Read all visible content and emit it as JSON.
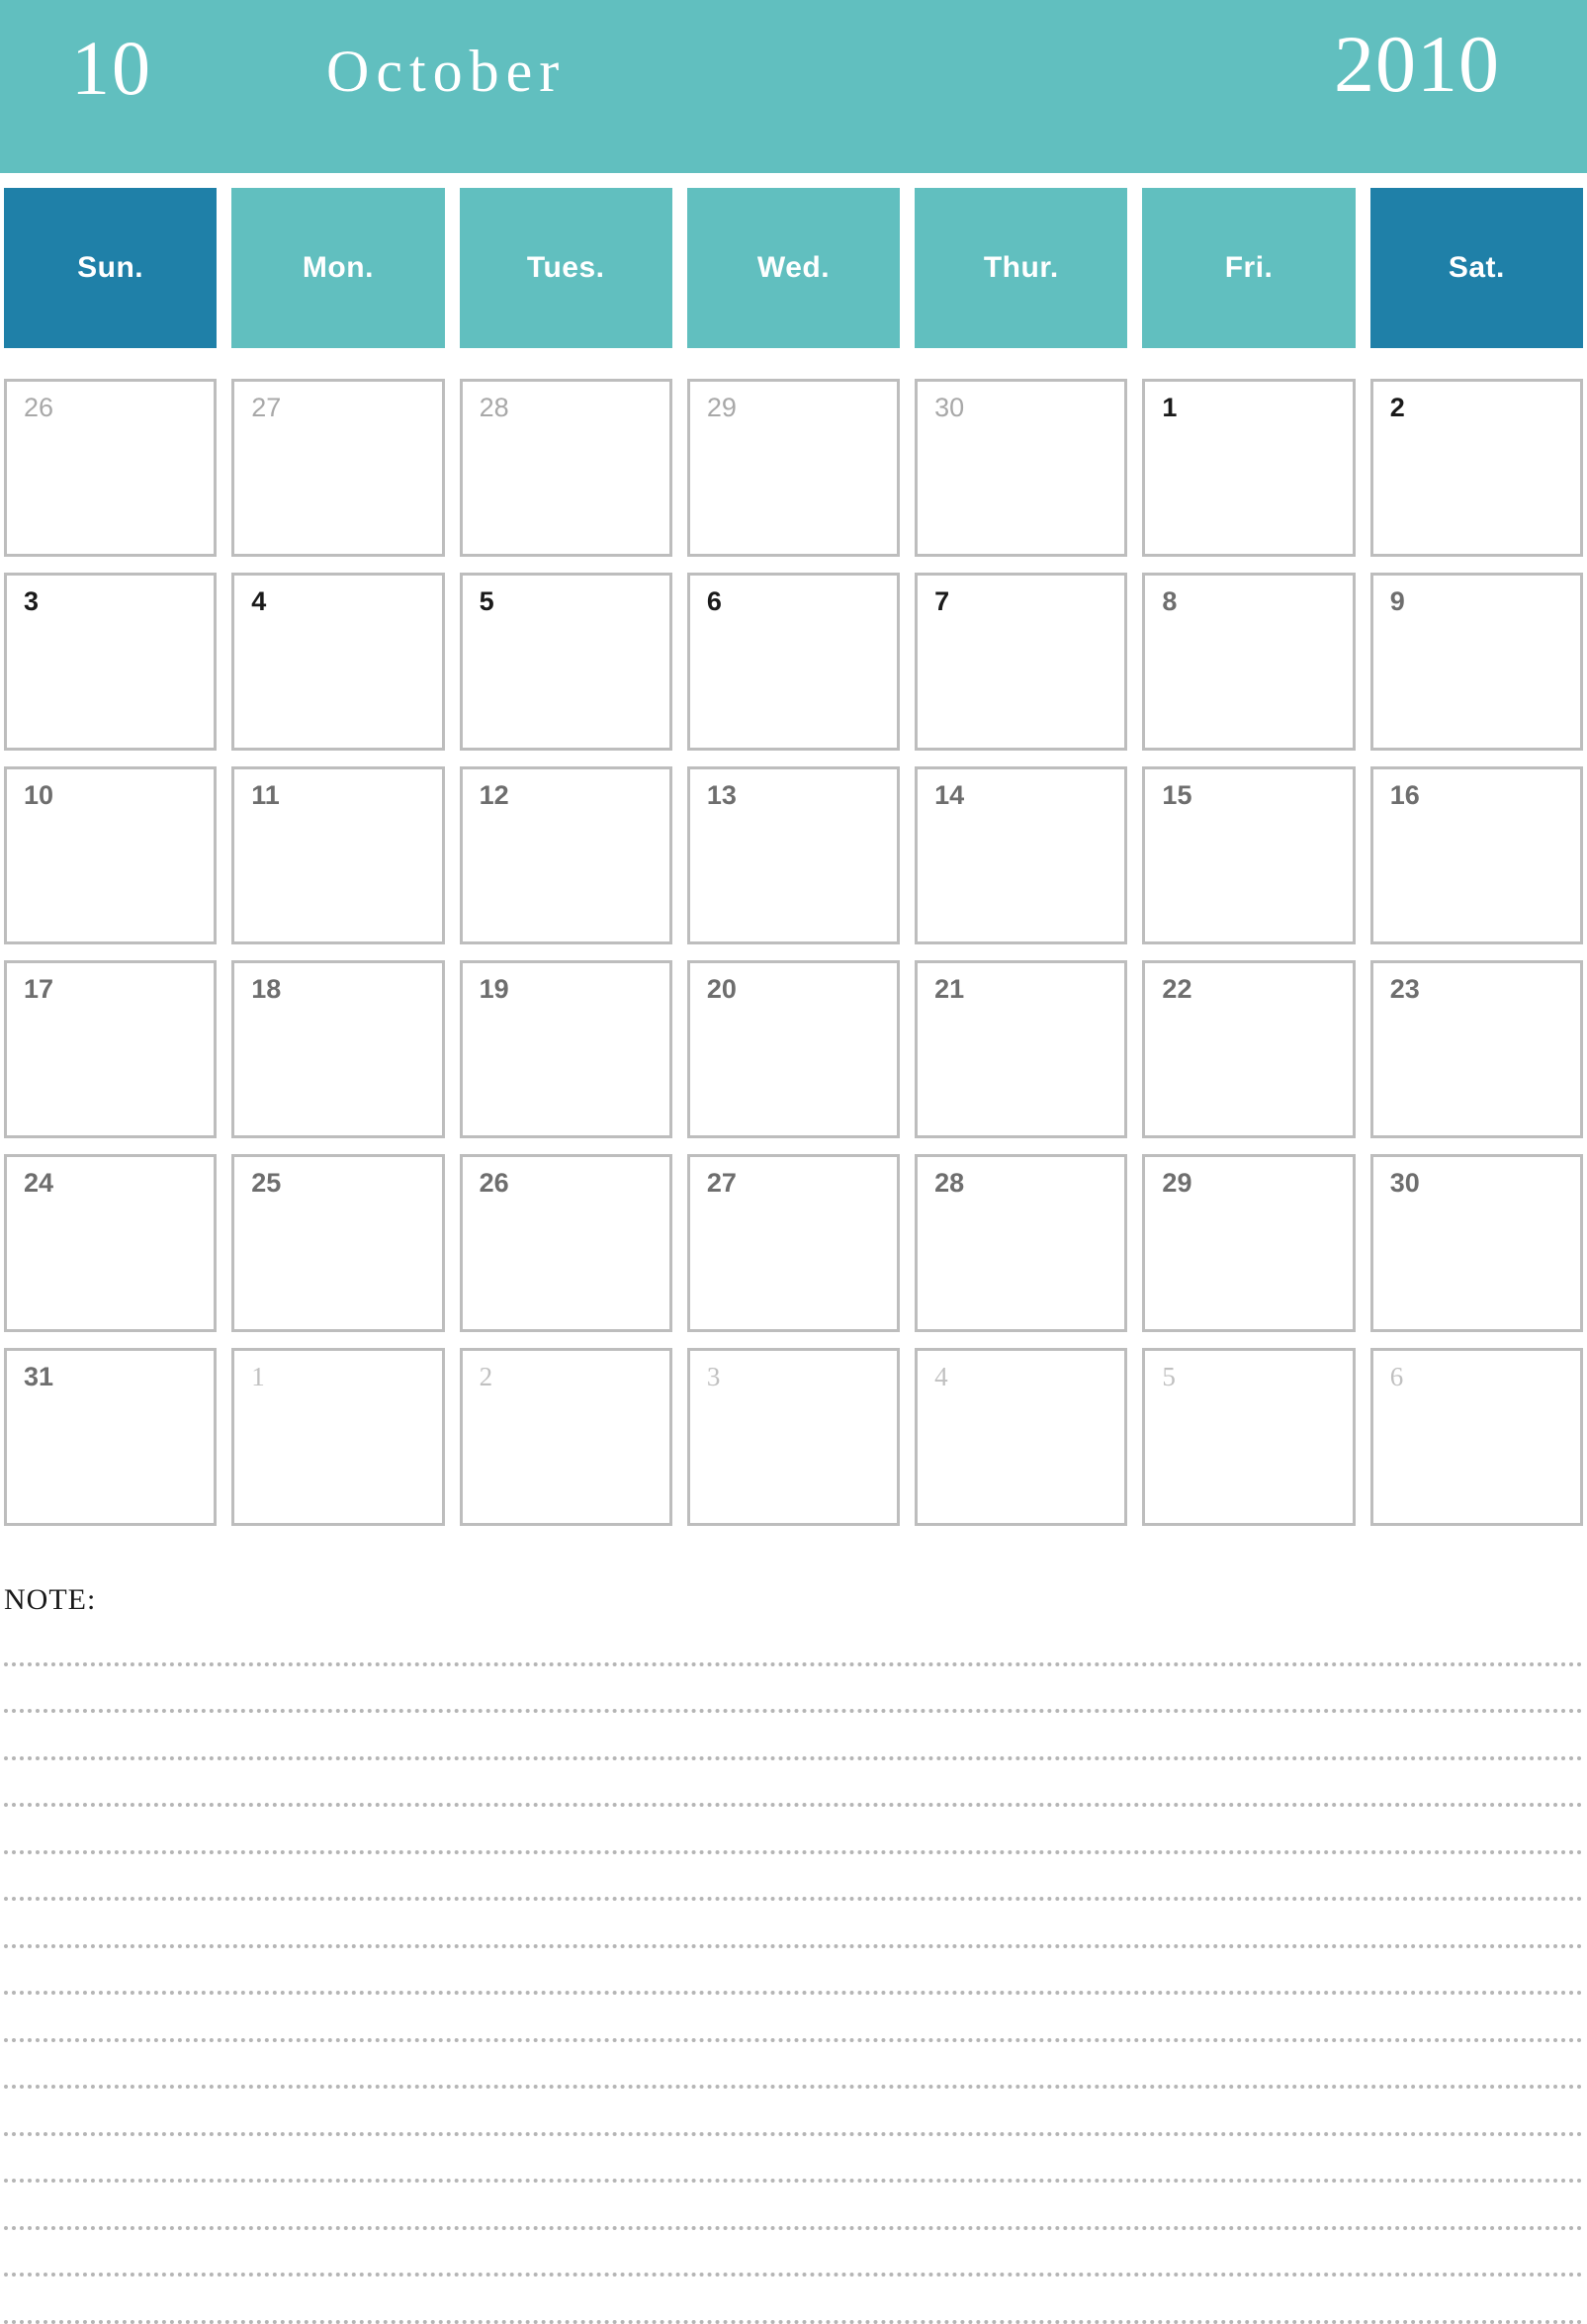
{
  "title": {
    "month_number": "10",
    "month_name": "October",
    "year": "2010"
  },
  "colors": {
    "banner_teal": "#61bfbf",
    "accent_blue": "#1f80a8",
    "cell_border": "#bdbdbd",
    "day_strong": "#1a1a1a",
    "day_mid": "#6e6e6e",
    "day_adjacent": "#c0c0c0",
    "note_rule": "#b5b5b5"
  },
  "weekdays": [
    {
      "label": "Sun.",
      "accent": true
    },
    {
      "label": "Mon.",
      "accent": false
    },
    {
      "label": "Tues.",
      "accent": false
    },
    {
      "label": "Wed.",
      "accent": false
    },
    {
      "label": "Thur.",
      "accent": false
    },
    {
      "label": "Fri.",
      "accent": false
    },
    {
      "label": "Sat.",
      "accent": true
    }
  ],
  "weeks": [
    [
      {
        "num": "26",
        "style": "adj-prev"
      },
      {
        "num": "27",
        "style": "adj-prev"
      },
      {
        "num": "28",
        "style": "adj-prev"
      },
      {
        "num": "29",
        "style": "adj-prev"
      },
      {
        "num": "30",
        "style": "adj-prev"
      },
      {
        "num": "1",
        "style": "cur-strong"
      },
      {
        "num": "2",
        "style": "cur-strong"
      }
    ],
    [
      {
        "num": "3",
        "style": "cur-strong"
      },
      {
        "num": "4",
        "style": "cur-strong"
      },
      {
        "num": "5",
        "style": "cur-strong"
      },
      {
        "num": "6",
        "style": "cur-strong"
      },
      {
        "num": "7",
        "style": "cur-strong"
      },
      {
        "num": "8",
        "style": "cur-mid"
      },
      {
        "num": "9",
        "style": "cur-mid"
      }
    ],
    [
      {
        "num": "10",
        "style": "cur-mid"
      },
      {
        "num": "11",
        "style": "cur-mid"
      },
      {
        "num": "12",
        "style": "cur-mid"
      },
      {
        "num": "13",
        "style": "cur-mid"
      },
      {
        "num": "14",
        "style": "cur-mid"
      },
      {
        "num": "15",
        "style": "cur-mid"
      },
      {
        "num": "16",
        "style": "cur-mid"
      }
    ],
    [
      {
        "num": "17",
        "style": "cur-mid"
      },
      {
        "num": "18",
        "style": "cur-mid"
      },
      {
        "num": "19",
        "style": "cur-mid"
      },
      {
        "num": "20",
        "style": "cur-mid"
      },
      {
        "num": "21",
        "style": "cur-mid"
      },
      {
        "num": "22",
        "style": "cur-mid"
      },
      {
        "num": "23",
        "style": "cur-mid"
      }
    ],
    [
      {
        "num": "24",
        "style": "cur-mid"
      },
      {
        "num": "25",
        "style": "cur-mid"
      },
      {
        "num": "26",
        "style": "cur-mid"
      },
      {
        "num": "27",
        "style": "cur-mid"
      },
      {
        "num": "28",
        "style": "cur-mid"
      },
      {
        "num": "29",
        "style": "cur-mid"
      },
      {
        "num": "30",
        "style": "cur-mid"
      }
    ],
    [
      {
        "num": "31",
        "style": "cur-mid"
      },
      {
        "num": "1",
        "style": "adj"
      },
      {
        "num": "2",
        "style": "adj"
      },
      {
        "num": "3",
        "style": "adj"
      },
      {
        "num": "4",
        "style": "adj"
      },
      {
        "num": "5",
        "style": "adj"
      },
      {
        "num": "6",
        "style": "adj"
      }
    ]
  ],
  "note": {
    "label": "NOTE:",
    "line_count": 15
  }
}
